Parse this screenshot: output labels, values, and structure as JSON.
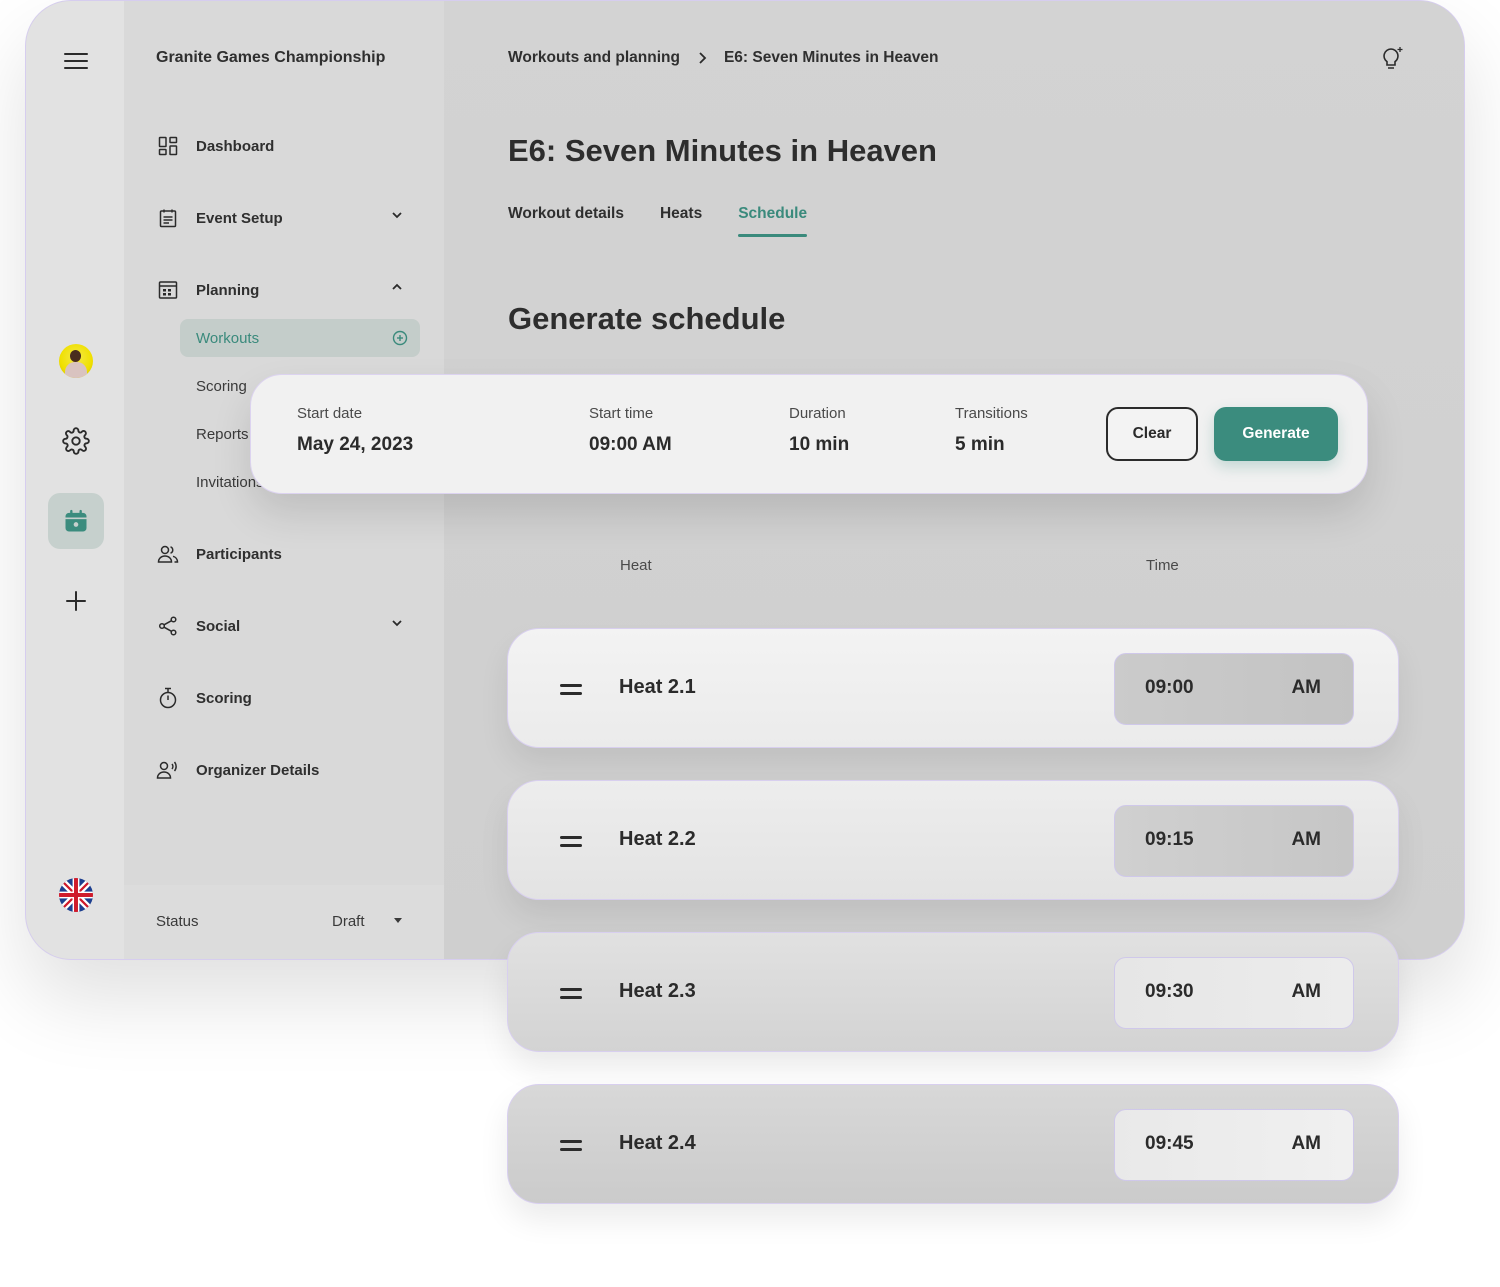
{
  "app": {
    "title": "Granite Games Championship"
  },
  "sidebar": {
    "items": [
      {
        "label": "Dashboard"
      },
      {
        "label": "Event Setup"
      },
      {
        "label": "Planning"
      },
      {
        "label": "Participants"
      },
      {
        "label": "Social"
      },
      {
        "label": "Scoring"
      },
      {
        "label": "Organizer Details"
      }
    ],
    "planning_sub": [
      {
        "label": "Workouts"
      },
      {
        "label": "Scoring"
      },
      {
        "label": "Reports"
      },
      {
        "label": "Invitations"
      }
    ],
    "status": {
      "label": "Status",
      "value": "Draft"
    }
  },
  "breadcrumb": {
    "parent": "Workouts and planning",
    "current": "E6: Seven Minutes in Heaven"
  },
  "page": {
    "title": "E6: Seven Minutes in Heaven"
  },
  "tabs": [
    {
      "label": "Workout details"
    },
    {
      "label": "Heats"
    },
    {
      "label": "Schedule"
    }
  ],
  "schedule": {
    "title": "Generate schedule",
    "start_date": {
      "label": "Start date",
      "value": "May 24, 2023"
    },
    "start_time": {
      "label": "Start time",
      "value": "09:00 AM"
    },
    "duration": {
      "label": "Duration",
      "value": "10 min"
    },
    "transitions": {
      "label": "Transitions",
      "value": "5 min"
    },
    "clear_label": "Clear",
    "generate_label": "Generate"
  },
  "table": {
    "columns": [
      "Heat",
      "Time"
    ],
    "rows": [
      {
        "heat": "Heat 2.1",
        "time": "09:00",
        "period": "AM"
      },
      {
        "heat": "Heat 2.2",
        "time": "09:15",
        "period": "AM"
      },
      {
        "heat": "Heat 2.3",
        "time": "09:30",
        "period": "AM"
      },
      {
        "heat": "Heat 2.4",
        "time": "09:45",
        "period": "AM"
      }
    ]
  },
  "colors": {
    "accent": "#3b8c7e",
    "text": "#2b2b2b"
  }
}
